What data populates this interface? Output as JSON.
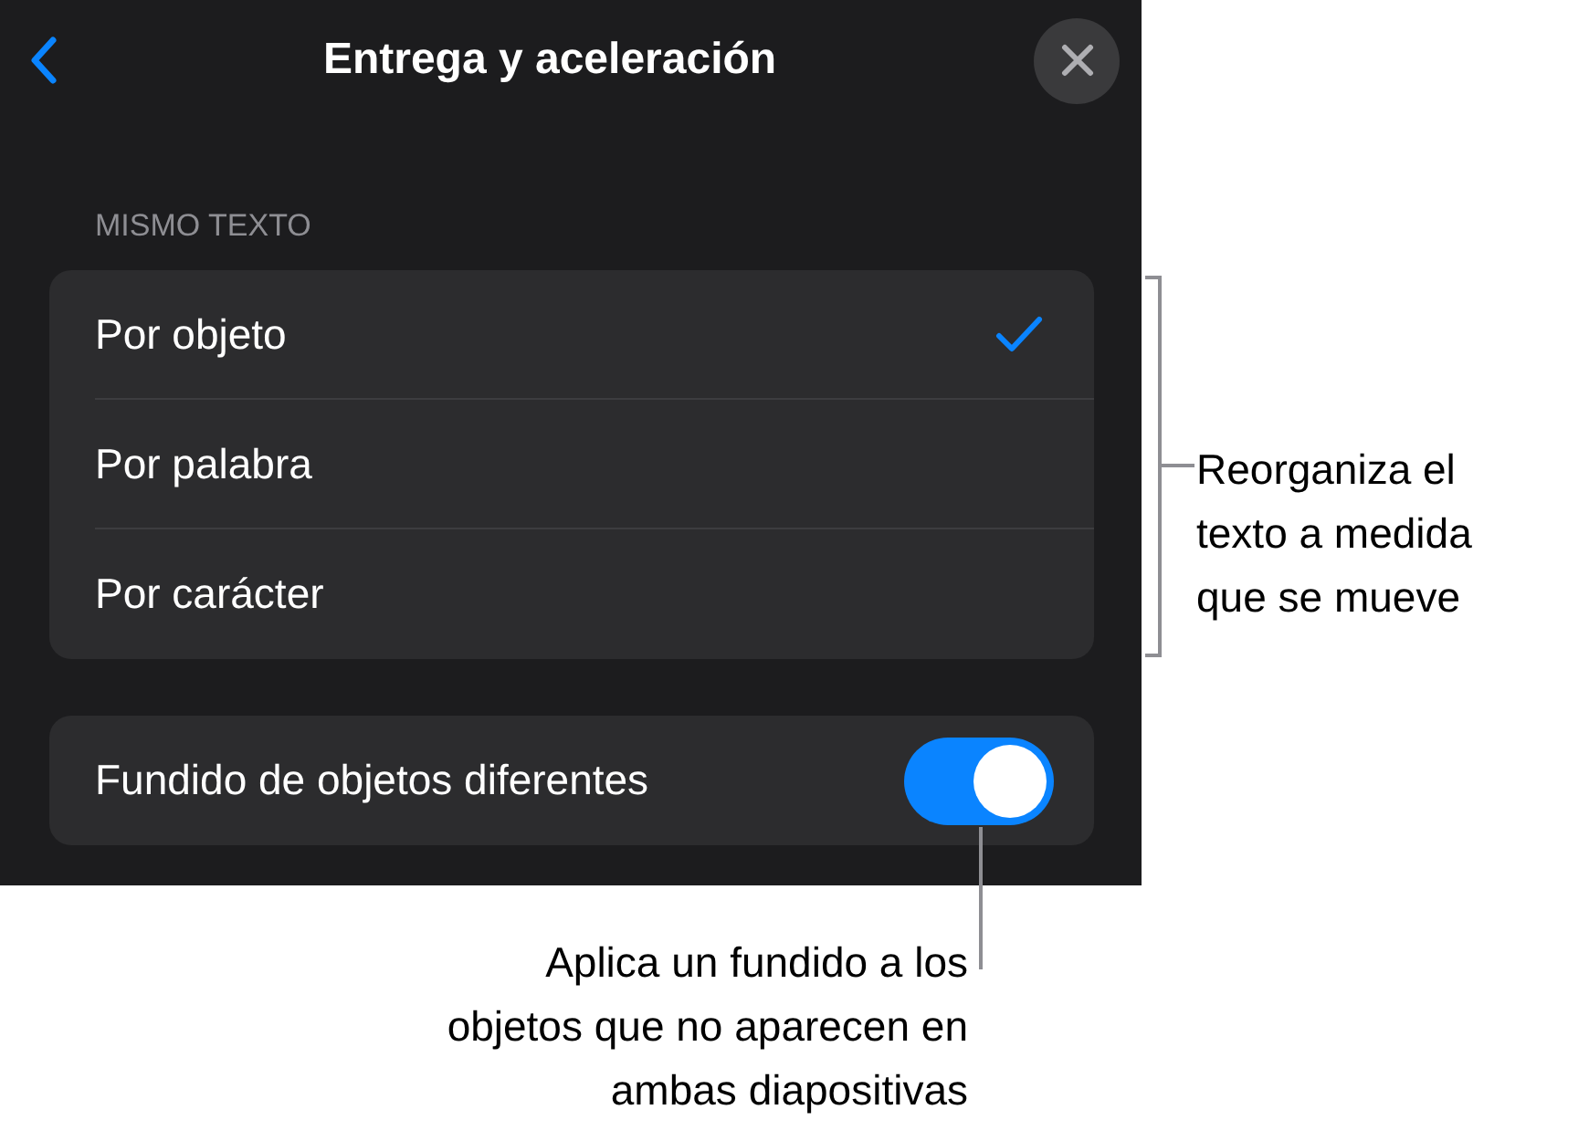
{
  "header": {
    "title": "Entrega y aceleración"
  },
  "section": {
    "title": "MISMO TEXTO",
    "options": [
      {
        "label": "Por objeto",
        "selected": true
      },
      {
        "label": "Por palabra",
        "selected": false
      },
      {
        "label": "Por carácter",
        "selected": false
      }
    ]
  },
  "toggle_row": {
    "label": "Fundido de objetos diferentes",
    "on": true
  },
  "callouts": [
    {
      "text": "Reorganiza el\ntexto a medida\nque se mueve"
    },
    {
      "text": "Aplica un fundido a los\nobjetos que no aparecen en\nambas diapositivas"
    }
  ]
}
